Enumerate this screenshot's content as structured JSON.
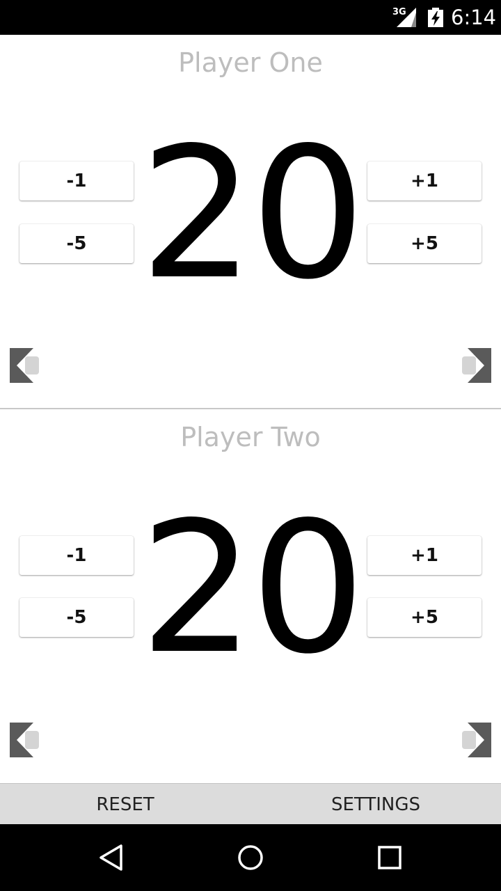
{
  "status_bar": {
    "network": "3G",
    "time": "6:14",
    "icons": [
      "signal-icon",
      "battery-charging-icon"
    ]
  },
  "players": [
    {
      "name": "Player One",
      "life": "20",
      "buttons": {
        "minus1": "-1",
        "minus5": "-5",
        "plus1": "+1",
        "plus5": "+5"
      }
    },
    {
      "name": "Player Two",
      "life": "20",
      "buttons": {
        "minus1": "-1",
        "minus5": "-5",
        "plus1": "+1",
        "plus5": "+5"
      }
    }
  ],
  "bottom_bar": {
    "reset_label": "RESET",
    "settings_label": "SETTINGS"
  },
  "nav_bar": {
    "icons": [
      "back-icon",
      "home-icon",
      "recents-icon"
    ]
  },
  "colors": {
    "player_name": "#bdbdbd",
    "life_total": "#000000",
    "bottom_bar_bg": "#dcdcdc",
    "arrow_dark": "#5a5a5a",
    "arrow_light": "#d4d4d4"
  }
}
